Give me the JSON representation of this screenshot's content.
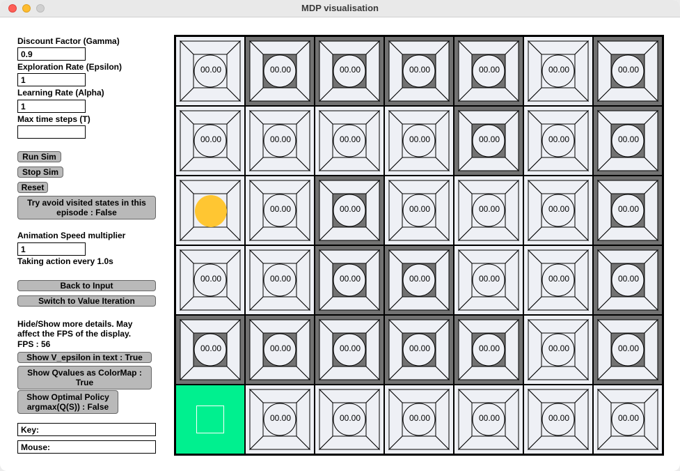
{
  "window": {
    "title": "MDP visualisation"
  },
  "inputs": {
    "gamma_label": "Discount Factor (Gamma)",
    "gamma_value": "0.9",
    "epsilon_label": "Exploration Rate (Epsilon)",
    "epsilon_value": "1",
    "alpha_label": "Learning Rate (Alpha)",
    "alpha_value": "1",
    "maxsteps_label": "Max time steps (T)",
    "maxsteps_value": ""
  },
  "buttons": {
    "run": "Run Sim",
    "stop": "Stop Sim",
    "reset": "Reset",
    "avoid_line1": "Try avoid visited states in this",
    "avoid_line2": "episode : False",
    "back": "Back to Input",
    "switch": "Switch to Value Iteration",
    "show_v": "Show V_epsilon in text : True",
    "show_q_line1": "Show Qvalues as ColorMap :",
    "show_q_line2": "True",
    "show_policy_line1": "Show Optimal Policy",
    "show_policy_line2": "argmax(Q(S)) : False"
  },
  "animation": {
    "label": "Animation Speed multiplier",
    "value": "1",
    "status": "Taking action every 1.0s"
  },
  "details": {
    "line1": "Hide/Show more details. May",
    "line2": "affect the FPS of the display.",
    "fps": "FPS : 56"
  },
  "status_fields": {
    "key": "Key:",
    "mouse": "Mouse:"
  },
  "colors": {
    "light_cell": "#eef0f5",
    "dark_cell": "#727272",
    "goal": "#00f08f",
    "agent": "#ffc632"
  },
  "grid": {
    "rows": 6,
    "cols": 7,
    "agent": [
      2,
      0
    ],
    "goal": [
      5,
      0
    ],
    "cells": [
      [
        {
          "value": "00.00",
          "dark": false
        },
        {
          "value": "00.00",
          "dark": true
        },
        {
          "value": "00.00",
          "dark": true
        },
        {
          "value": "00.00",
          "dark": true
        },
        {
          "value": "00.00",
          "dark": true
        },
        {
          "value": "00.00",
          "dark": false
        },
        {
          "value": "00.00",
          "dark": true
        }
      ],
      [
        {
          "value": "00.00",
          "dark": false
        },
        {
          "value": "00.00",
          "dark": false
        },
        {
          "value": "00.00",
          "dark": false
        },
        {
          "value": "00.00",
          "dark": false
        },
        {
          "value": "00.00",
          "dark": true
        },
        {
          "value": "00.00",
          "dark": false
        },
        {
          "value": "00.00",
          "dark": true
        }
      ],
      [
        {
          "value": "",
          "dark": false
        },
        {
          "value": "00.00",
          "dark": false
        },
        {
          "value": "00.00",
          "dark": true
        },
        {
          "value": "00.00",
          "dark": false
        },
        {
          "value": "00.00",
          "dark": false
        },
        {
          "value": "00.00",
          "dark": false
        },
        {
          "value": "00.00",
          "dark": true
        }
      ],
      [
        {
          "value": "00.00",
          "dark": false
        },
        {
          "value": "00.00",
          "dark": false
        },
        {
          "value": "00.00",
          "dark": true
        },
        {
          "value": "00.00",
          "dark": true
        },
        {
          "value": "00.00",
          "dark": false
        },
        {
          "value": "00.00",
          "dark": false
        },
        {
          "value": "00.00",
          "dark": true
        }
      ],
      [
        {
          "value": "00.00",
          "dark": true
        },
        {
          "value": "00.00",
          "dark": true
        },
        {
          "value": "00.00",
          "dark": true
        },
        {
          "value": "00.00",
          "dark": true
        },
        {
          "value": "00.00",
          "dark": true
        },
        {
          "value": "00.00",
          "dark": false
        },
        {
          "value": "00.00",
          "dark": true
        }
      ],
      [
        {
          "value": "",
          "dark": false
        },
        {
          "value": "00.00",
          "dark": false
        },
        {
          "value": "00.00",
          "dark": false
        },
        {
          "value": "00.00",
          "dark": false
        },
        {
          "value": "00.00",
          "dark": false
        },
        {
          "value": "00.00",
          "dark": false
        },
        {
          "value": "00.00",
          "dark": false
        }
      ]
    ]
  }
}
